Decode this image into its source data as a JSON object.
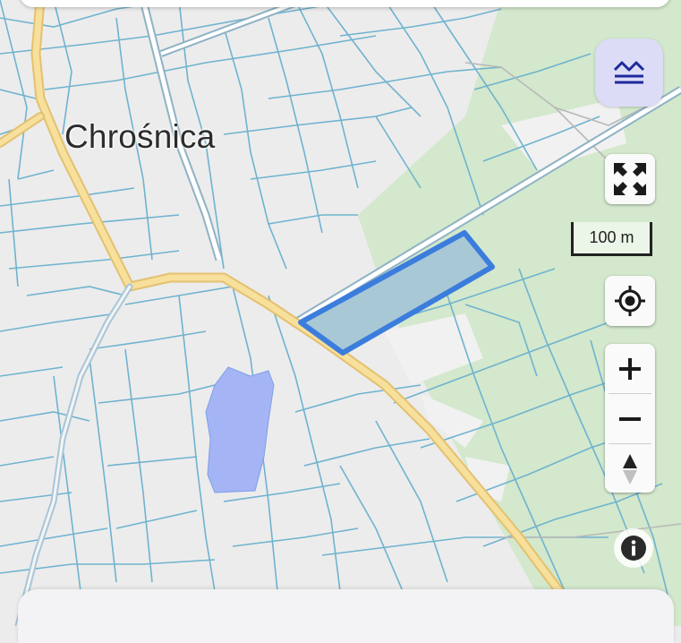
{
  "map": {
    "place_label": "Chrośnica",
    "scale_label": "100 m",
    "colors": {
      "background": "#ececec",
      "parcel_line": "#6fb3cf",
      "road": "#f7df9c",
      "road_outline": "#e3c16f",
      "forest": "#d3e8cc",
      "water": "#a4b4f5",
      "selected_fill": "#a9c8d6",
      "selected_outline": "#3b7ddd"
    }
  },
  "controls": {
    "layers": {
      "icon": "layers-icon",
      "color": "#1e2a9a"
    },
    "fullscreen": {
      "icon": "fullscreen-icon"
    },
    "locate": {
      "icon": "locate-icon"
    },
    "zoom_in": {
      "icon": "plus-icon"
    },
    "zoom_out": {
      "icon": "minus-icon"
    },
    "compass": {
      "icon": "compass-icon"
    },
    "info": {
      "icon": "info-icon"
    }
  }
}
